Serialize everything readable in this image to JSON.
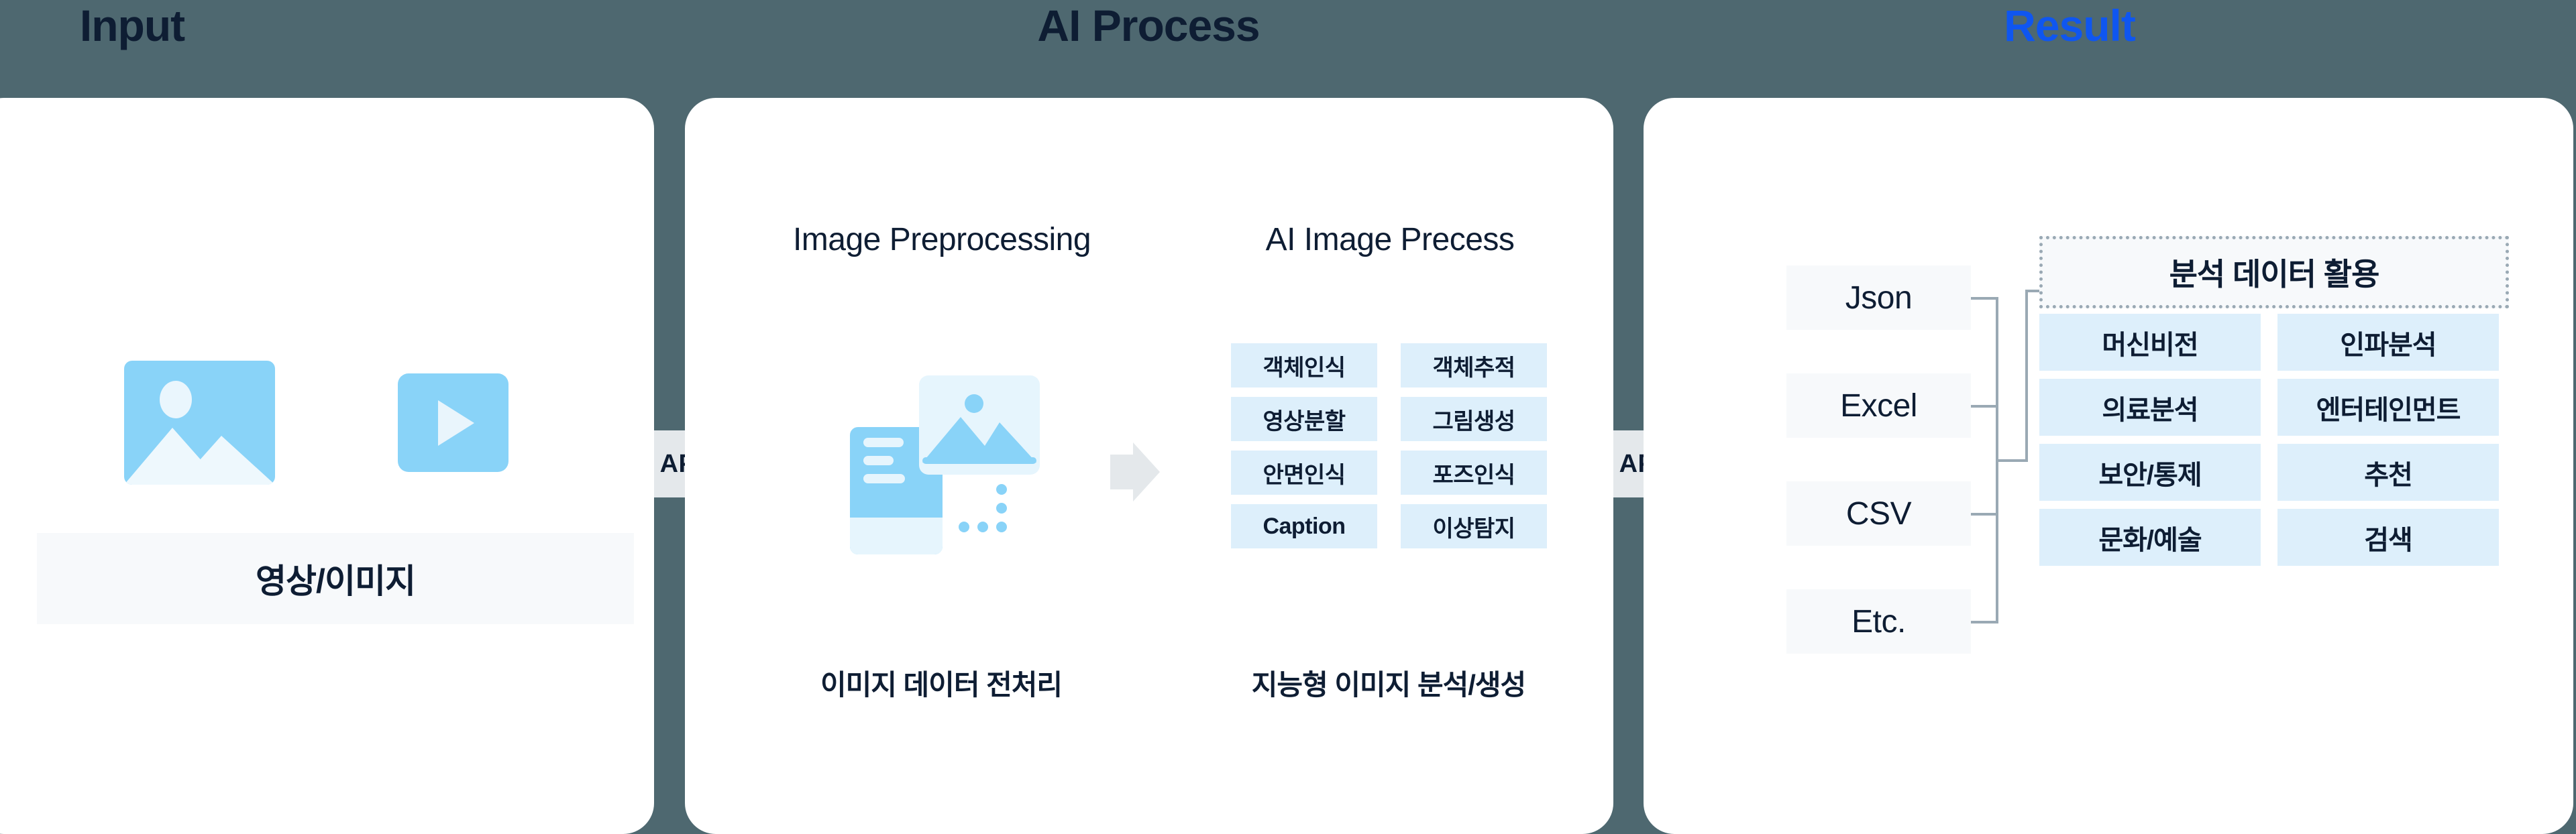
{
  "headings": {
    "input": "Input",
    "ai_process": "AI Process",
    "result": "Result"
  },
  "colors": {
    "background": "#4e6870",
    "panel": "#ffffff",
    "accent_blue": "#0f56f0",
    "icon_blue": "#89d3f8",
    "tag_blue": "#ddeffb",
    "box_gray": "#f7f9fb",
    "arrow_gray": "#e4e8eb",
    "connector_gray": "#9aa9b4",
    "text_dark": "#0e1d33"
  },
  "input_panel": {
    "icons": [
      {
        "name": "image-icon",
        "label": "image"
      },
      {
        "name": "video-icon",
        "label": "video"
      }
    ],
    "media_label": "영상/이미지"
  },
  "api_arrows": [
    {
      "label": "API"
    },
    {
      "label": "API"
    }
  ],
  "process_panel": {
    "preprocessing": {
      "title": "Image Preprocessing",
      "caption": "이미지 데이터 전처리"
    },
    "ai_image": {
      "title": "AI Image Precess",
      "caption": "지능형 이미지 분석/생성",
      "tags_left": [
        "객체인식",
        "영상분할",
        "안면인식",
        "Caption"
      ],
      "tags_right": [
        "객체추적",
        "그림생성",
        "포즈인식",
        "이상탐지"
      ]
    }
  },
  "result_panel": {
    "formats": [
      "Json",
      "Excel",
      "CSV",
      "Etc."
    ],
    "usage_header": "분석 데이터 활용",
    "usage_left": [
      "머신비전",
      "의료분석",
      "보안/통제",
      "문화/예술"
    ],
    "usage_right": [
      "인파분석",
      "엔터테인먼트",
      "추천",
      "검색"
    ]
  }
}
